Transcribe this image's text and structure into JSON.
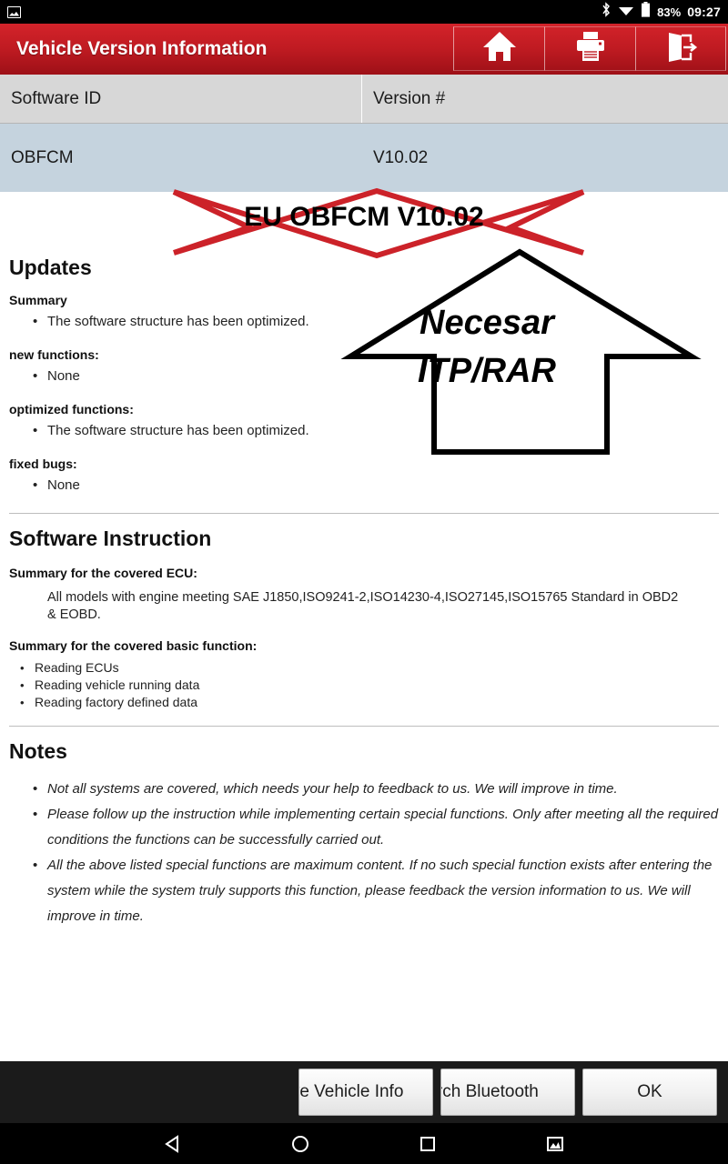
{
  "status_bar": {
    "left_icon": "gallery-icon",
    "icons": [
      "bluetooth-icon",
      "wifi-icon",
      "battery-icon"
    ],
    "battery_percent": "83%",
    "time": "09:27"
  },
  "app_bar": {
    "title": "Vehicle Version Information",
    "background_color": "#c01b22",
    "buttons": [
      {
        "name": "home-button",
        "icon": "home-icon"
      },
      {
        "name": "print-button",
        "icon": "printer-icon"
      },
      {
        "name": "exit-button",
        "icon": "exit-icon"
      }
    ]
  },
  "table": {
    "headers": [
      "Software ID",
      "Version #"
    ],
    "rows": [
      {
        "software_id": "OBFCM",
        "version": "V10.02"
      }
    ],
    "header_bg": "#d7d7d7",
    "row_bg": "#c5d3de"
  },
  "annotations": {
    "banner": {
      "text": "EU OBFCM V10.02",
      "shape": "ribbon-banner",
      "color": "#cc2229"
    },
    "arrow": {
      "line1": "Necesar",
      "line2": "ITP/RAR",
      "shape": "up-arrow",
      "color": "#000000"
    }
  },
  "updates": {
    "heading": "Updates",
    "groups": [
      {
        "label": "Summary",
        "items": [
          "The software structure has been optimized."
        ]
      },
      {
        "label": "new functions:",
        "items": [
          "None"
        ]
      },
      {
        "label": "optimized functions:",
        "items": [
          "The software structure has been optimized."
        ]
      },
      {
        "label": "fixed bugs:",
        "items": [
          "None"
        ]
      }
    ]
  },
  "software_instruction": {
    "heading": "Software Instruction",
    "ecu_label": "Summary for the covered ECU:",
    "ecu_text": "All models with engine meeting SAE J1850,ISO9241-2,ISO14230-4,ISO27145,ISO15765 Standard in OBD2 & EOBD.",
    "basic_label": "Summary for the covered basic function:",
    "basic_items": [
      "Reading ECUs",
      "Reading vehicle running data",
      "Reading factory defined data"
    ]
  },
  "notes": {
    "heading": "Notes",
    "color": "#cf3b37",
    "items": [
      "Not all systems are covered, which needs your help to feedback to us. We will improve in time.",
      "Please follow up the instruction while implementing certain special functions. Only after meeting all the required conditions the functions can be successfully carried out.",
      "All the above listed special functions are maximum content. If no such special function exists after entering the system while the system truly supports this function, please feedback the version information to us. We will improve in time."
    ]
  },
  "bottom_bar": {
    "buttons": [
      {
        "name": "save-vehicle-info-button",
        "label": "Save Vehicle Info"
      },
      {
        "name": "search-bluetooth-button",
        "label": "Search Bluetooth"
      },
      {
        "name": "ok-button",
        "label": "OK"
      }
    ]
  },
  "nav_bar": {
    "items": [
      {
        "name": "nav-back",
        "icon": "back-triangle-icon"
      },
      {
        "name": "nav-home",
        "icon": "home-circle-icon"
      },
      {
        "name": "nav-recents",
        "icon": "recents-square-icon"
      },
      {
        "name": "nav-screenshot",
        "icon": "screenshot-image-icon"
      }
    ]
  }
}
